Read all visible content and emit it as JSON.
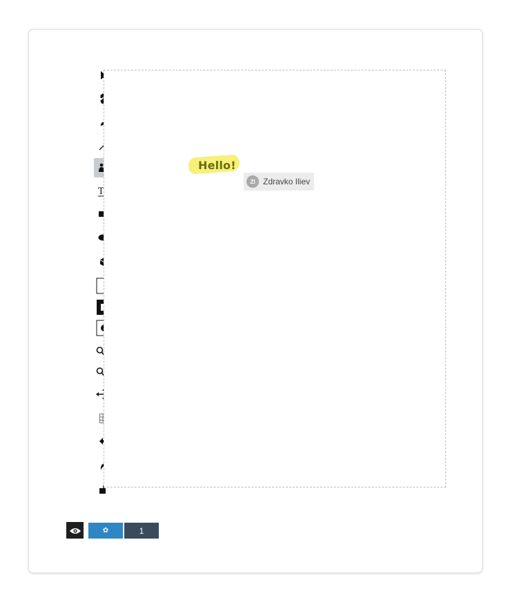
{
  "toolbar": {
    "tools": [
      {
        "name": "select-arrow-icon"
      },
      {
        "name": "pan-hand-icon"
      },
      {
        "name": "brush-icon"
      },
      {
        "name": "line-icon"
      },
      {
        "name": "highlighter-icon",
        "active": true
      },
      {
        "name": "text-tool-icon"
      },
      {
        "name": "rectangle-icon"
      },
      {
        "name": "ellipse-icon"
      },
      {
        "name": "3d-box-icon"
      },
      {
        "name": "fill-none-icon"
      },
      {
        "name": "stroke-square-icon"
      },
      {
        "name": "dot-size-icon"
      },
      {
        "name": "zoom-in-icon"
      },
      {
        "name": "zoom-out-icon"
      },
      {
        "name": "move-arrows-icon"
      },
      {
        "name": "grid-icon"
      },
      {
        "name": "undo-icon"
      },
      {
        "name": "redo-icon"
      },
      {
        "name": "unlock-icon"
      }
    ]
  },
  "canvas": {
    "text": "Hello!",
    "highlight_color": "#f4f06a",
    "user_tag": {
      "initials": "ZI",
      "name": "Zdravko Iliev"
    }
  },
  "footer": {
    "eye_label": "view",
    "gear_label": "✿",
    "user_count": "1"
  },
  "colors": {
    "active_tool_bg": "#c7ccd1",
    "gear_button": "#2f86c4",
    "count_button": "#3a4b5e",
    "eye_button": "#1f1f1f"
  }
}
